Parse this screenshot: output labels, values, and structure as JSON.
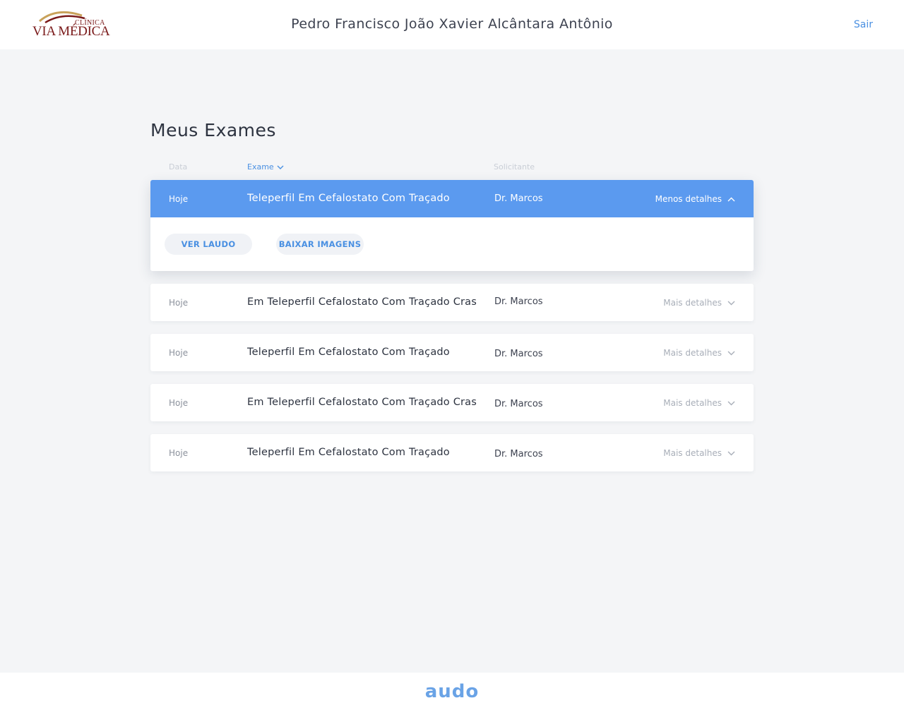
{
  "header": {
    "logo_small": "CLÍNICA",
    "logo_big": "VIA MÉDICA",
    "patient_name": "Pedro Francisco João Xavier Alcântara Antônio",
    "logout_label": "Sair"
  },
  "main": {
    "title": "Meus Exames",
    "columns": {
      "date": "Data",
      "exam": "Exame",
      "requester": "Solicitante"
    },
    "expanded": {
      "date": "Hoje",
      "exam": "Teleperfil Em Cefalostato Com Traçado",
      "doctor": "Dr. Marcos",
      "details_label": "Menos detalhes",
      "actions": {
        "report": "VER LAUDO",
        "images": "BAIXAR IMAGENS"
      }
    },
    "exams": [
      {
        "date": "Hoje",
        "exam": "Em Teleperfil Cefalostato Com Traçado Cras",
        "doctor": "Dr. Marcos",
        "details_label": "Mais detalhes"
      },
      {
        "date": "Hoje",
        "exam": "Teleperfil Em Cefalostato Com Traçado",
        "doctor": "Dr. Marcos",
        "details_label": "Mais detalhes"
      },
      {
        "date": "Hoje",
        "exam": "Em Teleperfil Cefalostato Com Traçado Cras",
        "doctor": "Dr. Marcos",
        "details_label": "Mais detalhes"
      },
      {
        "date": "Hoje",
        "exam": "Teleperfil Em Cefalostato Com Traçado",
        "doctor": "Dr. Marcos",
        "details_label": "Mais detalhes"
      }
    ]
  },
  "footer": {
    "brand": "audo"
  },
  "colors": {
    "accent": "#5b9aef",
    "link": "#4a90e2",
    "brand_red": "#7a1a1a",
    "background": "#f4f5f7"
  }
}
